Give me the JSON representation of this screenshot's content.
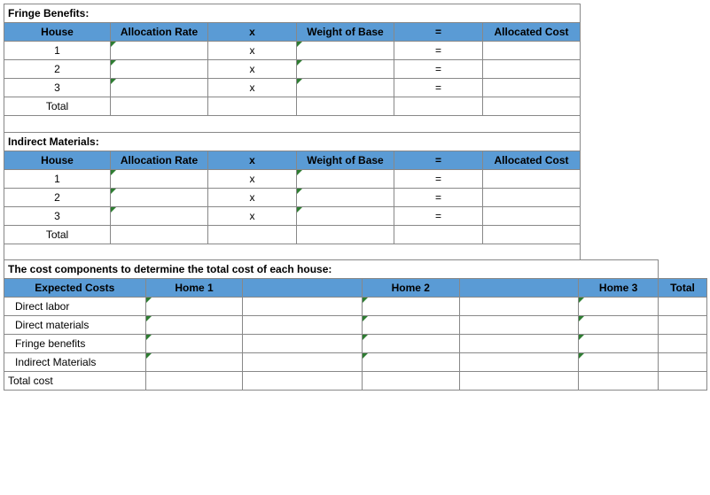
{
  "sections": {
    "fringe": {
      "title": "Fringe Benefits:",
      "headers": {
        "house": "House",
        "rate": "Allocation Rate",
        "x": "x",
        "weight": "Weight of Base",
        "eq": "=",
        "cost": "Allocated Cost"
      },
      "rows": [
        {
          "house": "1",
          "rate": "",
          "x": "x",
          "weight": "",
          "eq": "=",
          "cost": ""
        },
        {
          "house": "2",
          "rate": "",
          "x": "x",
          "weight": "",
          "eq": "=",
          "cost": ""
        },
        {
          "house": "3",
          "rate": "",
          "x": "x",
          "weight": "",
          "eq": "=",
          "cost": ""
        }
      ],
      "total_label": "Total"
    },
    "indirect": {
      "title": "Indirect Materials:",
      "headers": {
        "house": "House",
        "rate": "Allocation Rate",
        "x": "x",
        "weight": "Weight of Base",
        "eq": "=",
        "cost": "Allocated Cost"
      },
      "rows": [
        {
          "house": "1",
          "rate": "",
          "x": "x",
          "weight": "",
          "eq": "=",
          "cost": ""
        },
        {
          "house": "2",
          "rate": "",
          "x": "x",
          "weight": "",
          "eq": "=",
          "cost": ""
        },
        {
          "house": "3",
          "rate": "",
          "x": "x",
          "weight": "",
          "eq": "=",
          "cost": ""
        }
      ],
      "total_label": "Total"
    },
    "components": {
      "title": "The cost components to determine the total cost of each house:",
      "headers": {
        "expected": "Expected Costs",
        "h1": "Home 1",
        "h2": "Home 2",
        "h3": "Home 3",
        "total": "Total"
      },
      "rows": [
        {
          "label": "Direct labor"
        },
        {
          "label": "Direct materials"
        },
        {
          "label": "Fringe benefits"
        },
        {
          "label": "Indirect Materials"
        }
      ],
      "total_label": "Total cost"
    }
  }
}
